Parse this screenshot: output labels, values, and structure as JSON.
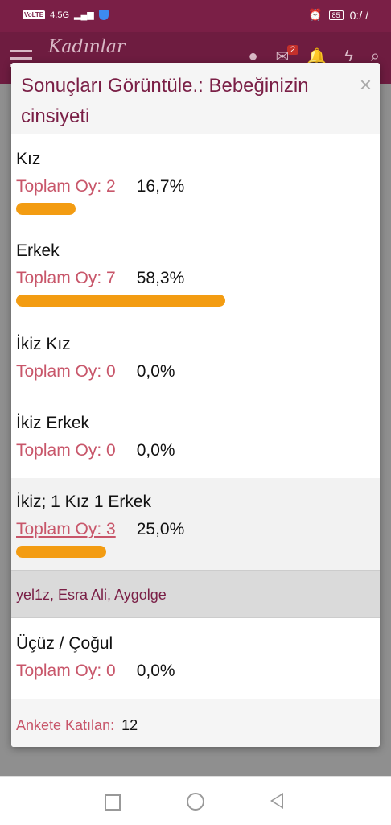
{
  "statusbar": {
    "network": "VoLTE",
    "signal": "4.5G",
    "time": "0:/ /",
    "battery": "85"
  },
  "app": {
    "logo": "Kadınlar",
    "notification_count": "2"
  },
  "dialog": {
    "title": "Sonuçları Görüntüle.: Bebeğinizin cinsiyeti",
    "close_label": "×",
    "options": [
      {
        "label": "Kız",
        "votes_text": "Toplam Oy: 2",
        "percent": "16,7%",
        "fraction": 0.167
      },
      {
        "label": "Erkek",
        "votes_text": "Toplam Oy: 7",
        "percent": "58,3%",
        "fraction": 0.583
      },
      {
        "label": "İkiz Kız",
        "votes_text": "Toplam Oy: 0",
        "percent": "0,0%",
        "fraction": 0
      },
      {
        "label": "İkiz Erkek",
        "votes_text": "Toplam Oy: 0",
        "percent": "0,0%",
        "fraction": 0
      },
      {
        "label": "İkiz; 1 Kız 1 Erkek",
        "votes_text": "Toplam Oy: 3",
        "percent": "25,0%",
        "fraction": 0.25
      },
      {
        "label": "Üçüz / Çoğul",
        "votes_text": "Toplam Oy: 0",
        "percent": "0,0%",
        "fraction": 0
      }
    ],
    "voters_list": "yel1z, Esra Ali, Aygolge",
    "footer": {
      "label": "Ankete Katılan:",
      "count": "12"
    }
  },
  "colors": {
    "brand": "#7a1f46",
    "bar": "#f39c12",
    "link": "#c8566a"
  }
}
